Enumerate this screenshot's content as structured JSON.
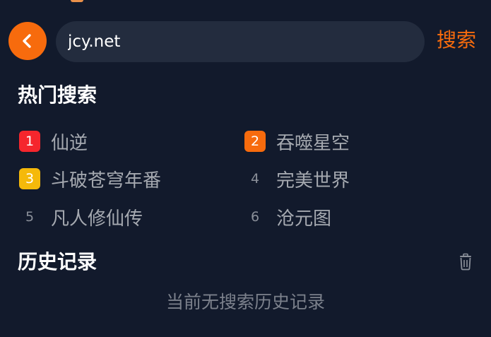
{
  "search": {
    "value": "jcy.net",
    "submit_label": "搜索"
  },
  "hot": {
    "title": "热门搜索",
    "items": [
      {
        "rank": "1",
        "label": "仙逆",
        "color": "#f5262d"
      },
      {
        "rank": "2",
        "label": "吞噬星空",
        "color": "#f76b0d"
      },
      {
        "rank": "3",
        "label": "斗破苍穹年番",
        "color": "#f5b90a"
      },
      {
        "rank": "4",
        "label": "完美世界",
        "color": ""
      },
      {
        "rank": "5",
        "label": "凡人修仙传",
        "color": ""
      },
      {
        "rank": "6",
        "label": "沧元图",
        "color": ""
      }
    ]
  },
  "history": {
    "title": "历史记录",
    "empty_text": "当前无搜索历史记录"
  },
  "colors": {
    "background": "#121a2c",
    "accent": "#f76b0d",
    "field": "#232c3e"
  },
  "icons": {
    "back": "chevron-left-icon",
    "clear": "trash-icon"
  }
}
